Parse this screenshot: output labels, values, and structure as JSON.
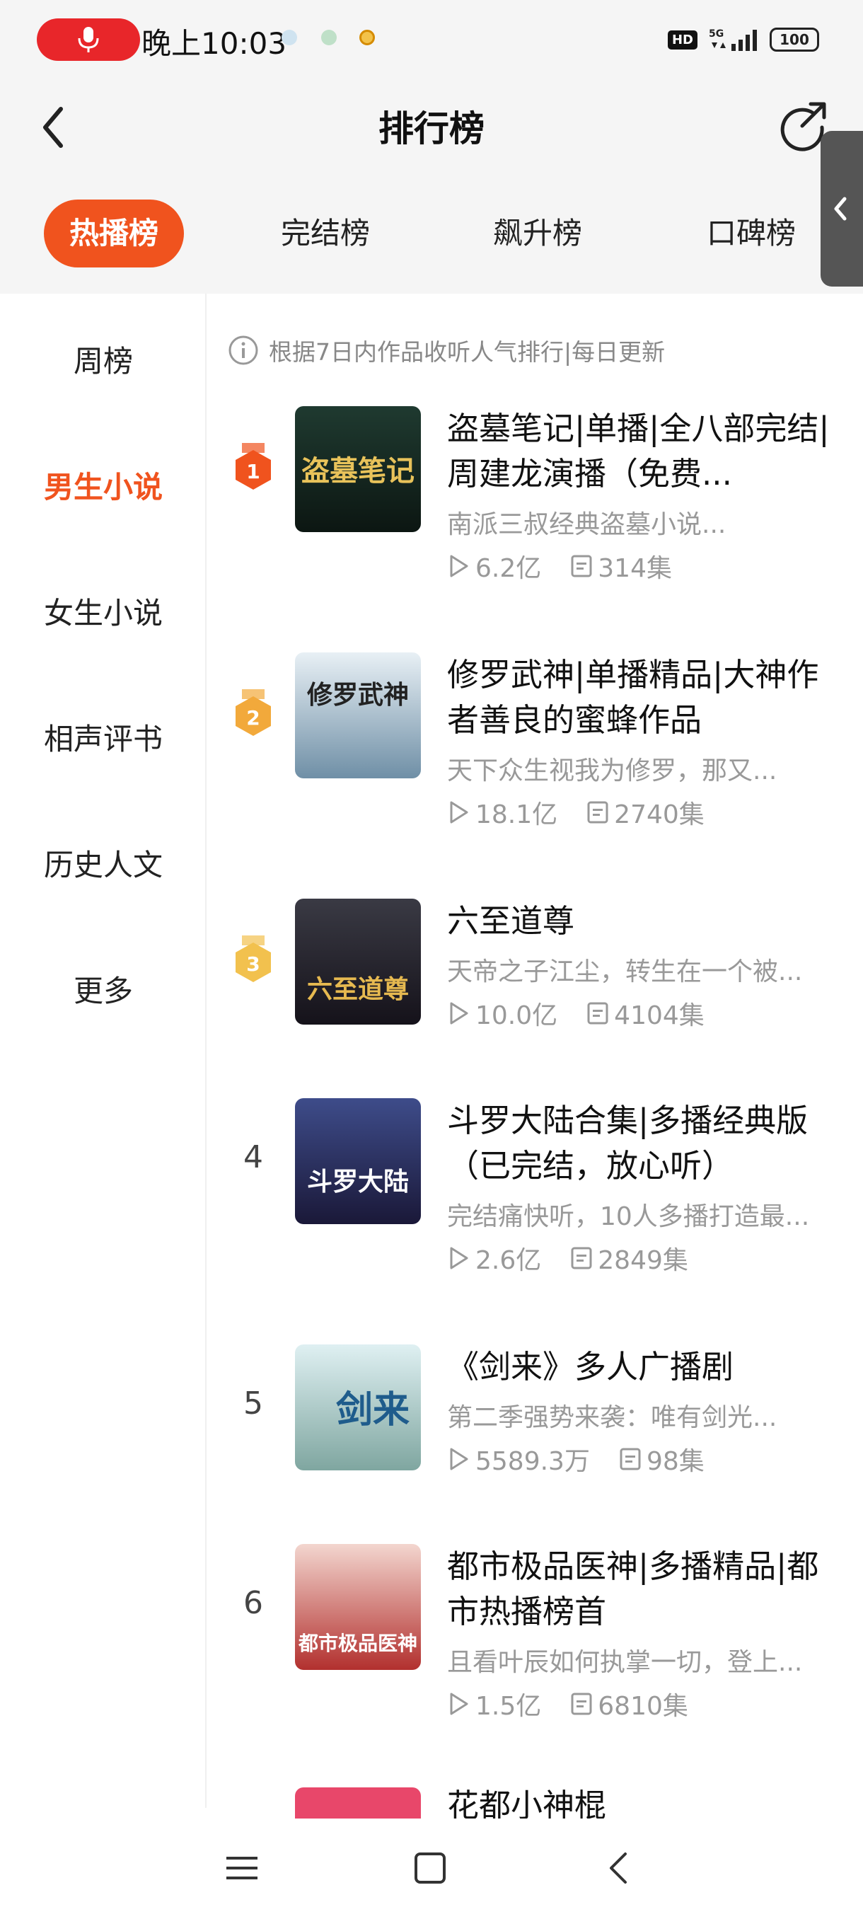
{
  "status_bar": {
    "time": "晚上10:03",
    "hd_badge": "HD",
    "network": "5G",
    "battery": "100"
  },
  "header": {
    "title": "排行榜"
  },
  "tabs": [
    {
      "label": "热播榜",
      "active": true
    },
    {
      "label": "完结榜",
      "active": false
    },
    {
      "label": "飙升榜",
      "active": false
    },
    {
      "label": "口碑榜",
      "active": false
    }
  ],
  "categories": [
    {
      "label": "周榜",
      "active": false
    },
    {
      "label": "男生小说",
      "active": true
    },
    {
      "label": "女生小说",
      "active": false
    },
    {
      "label": "相声评书",
      "active": false
    },
    {
      "label": "历史人文",
      "active": false
    },
    {
      "label": "更多",
      "active": false
    }
  ],
  "notice": "根据7日内作品收听人气排行|每日更新",
  "items": [
    {
      "rank": "1",
      "title": "盗墓笔记|单播|全八部完结|周建龙演播（免费...",
      "desc": "南派三叔经典盗墓小说...",
      "plays": "6.2亿",
      "episodes": "314集",
      "cover_text": "盗墓笔记"
    },
    {
      "rank": "2",
      "title": "修罗武神|单播精品|大神作者善良的蜜蜂作品",
      "desc": "天下众生视我为修罗，那又...",
      "plays": "18.1亿",
      "episodes": "2740集",
      "cover_text": "修罗武神"
    },
    {
      "rank": "3",
      "title": "六至道尊",
      "desc": "天帝之子江尘，转生在一个被...",
      "plays": "10.0亿",
      "episodes": "4104集",
      "cover_text": "六至道尊"
    },
    {
      "rank": "4",
      "title": "斗罗大陆合集|多播经典版（已完结，放心听）",
      "desc": "完结痛快听，10人多播打造最...",
      "plays": "2.6亿",
      "episodes": "2849集",
      "cover_text": "斗罗大陆"
    },
    {
      "rank": "5",
      "title": "《剑来》多人广播剧",
      "desc": "第二季强势来袭：唯有剑光...",
      "plays": "5589.3万",
      "episodes": "98集",
      "cover_text": "剑来"
    },
    {
      "rank": "6",
      "title": "都市极品医神|多播精品|都市热播榜首",
      "desc": "且看叶辰如何执掌一切，登上...",
      "plays": "1.5亿",
      "episodes": "6810集",
      "cover_text": "都市极品医神"
    },
    {
      "rank": "",
      "title": "花都小神棍",
      "desc": "",
      "plays": "",
      "episodes": "",
      "cover_text": ""
    }
  ],
  "colors": {
    "accent": "#f0531e",
    "gold": "#f2a93b",
    "mic": "#e8262a"
  }
}
